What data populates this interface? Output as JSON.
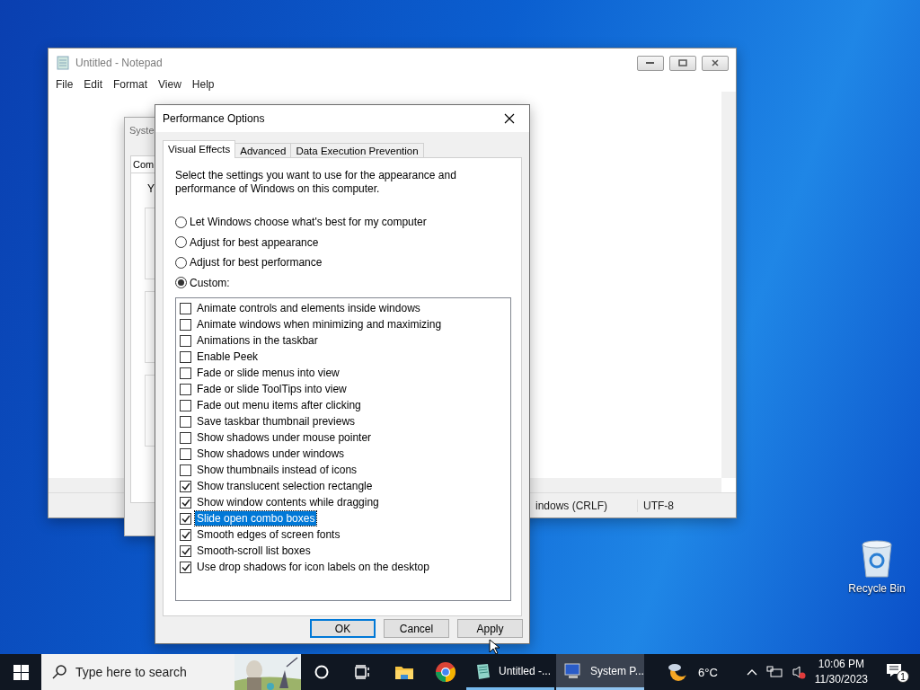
{
  "notepad": {
    "title": "Untitled - Notepad",
    "menu": [
      "File",
      "Edit",
      "Format",
      "View",
      "Help"
    ],
    "status": [
      "indows (CRLF)",
      "UTF-8"
    ]
  },
  "system_properties": {
    "title": "Syste",
    "tab": "Com",
    "text": "Y"
  },
  "dialog": {
    "title": "Performance Options",
    "tabs": [
      {
        "label": "Visual Effects",
        "selected": true
      },
      {
        "label": "Advanced",
        "selected": false
      },
      {
        "label": "Data Execution Prevention",
        "selected": false
      }
    ],
    "description": "Select the settings you want to use for the appearance and performance of Windows on this computer.",
    "options": [
      {
        "label": "Let Windows choose what's best for my computer",
        "selected": false
      },
      {
        "label": "Adjust for best appearance",
        "selected": false
      },
      {
        "label": "Adjust for best performance",
        "selected": false
      },
      {
        "label": "Custom:",
        "selected": true
      }
    ],
    "settings": [
      {
        "label": "Animate controls and elements inside windows",
        "checked": false,
        "selected": false
      },
      {
        "label": "Animate windows when minimizing and maximizing",
        "checked": false,
        "selected": false
      },
      {
        "label": "Animations in the taskbar",
        "checked": false,
        "selected": false
      },
      {
        "label": "Enable Peek",
        "checked": false,
        "selected": false
      },
      {
        "label": "Fade or slide menus into view",
        "checked": false,
        "selected": false
      },
      {
        "label": "Fade or slide ToolTips into view",
        "checked": false,
        "selected": false
      },
      {
        "label": "Fade out menu items after clicking",
        "checked": false,
        "selected": false
      },
      {
        "label": "Save taskbar thumbnail previews",
        "checked": false,
        "selected": false
      },
      {
        "label": "Show shadows under mouse pointer",
        "checked": false,
        "selected": false
      },
      {
        "label": "Show shadows under windows",
        "checked": false,
        "selected": false
      },
      {
        "label": "Show thumbnails instead of icons",
        "checked": false,
        "selected": false
      },
      {
        "label": "Show translucent selection rectangle",
        "checked": true,
        "selected": false
      },
      {
        "label": "Show window contents while dragging",
        "checked": true,
        "selected": false
      },
      {
        "label": "Slide open combo boxes",
        "checked": true,
        "selected": true
      },
      {
        "label": "Smooth edges of screen fonts",
        "checked": true,
        "selected": false
      },
      {
        "label": "Smooth-scroll list boxes",
        "checked": true,
        "selected": false
      },
      {
        "label": "Use drop shadows for icon labels on the desktop",
        "checked": true,
        "selected": false
      }
    ],
    "buttons": [
      {
        "label": "OK",
        "default": true
      },
      {
        "label": "Cancel",
        "default": false
      },
      {
        "label": "Apply",
        "default": false
      }
    ]
  },
  "desktop_icons": [
    {
      "label": "Recycle Bin"
    }
  ],
  "taskbar": {
    "search": {
      "placeholder": "Type here to search"
    },
    "pinned": [
      {
        "kind": "cortana"
      },
      {
        "kind": "taskview"
      },
      {
        "kind": "explorer"
      },
      {
        "kind": "chrome"
      }
    ],
    "apps": [
      {
        "label": "Untitled -...",
        "kind": "notepad",
        "selected": false
      },
      {
        "label": "System P...",
        "kind": "system",
        "selected": true
      }
    ],
    "weather": "6°C",
    "time": "10:06 PM",
    "date": "11/30/2023",
    "notifications": "1"
  }
}
